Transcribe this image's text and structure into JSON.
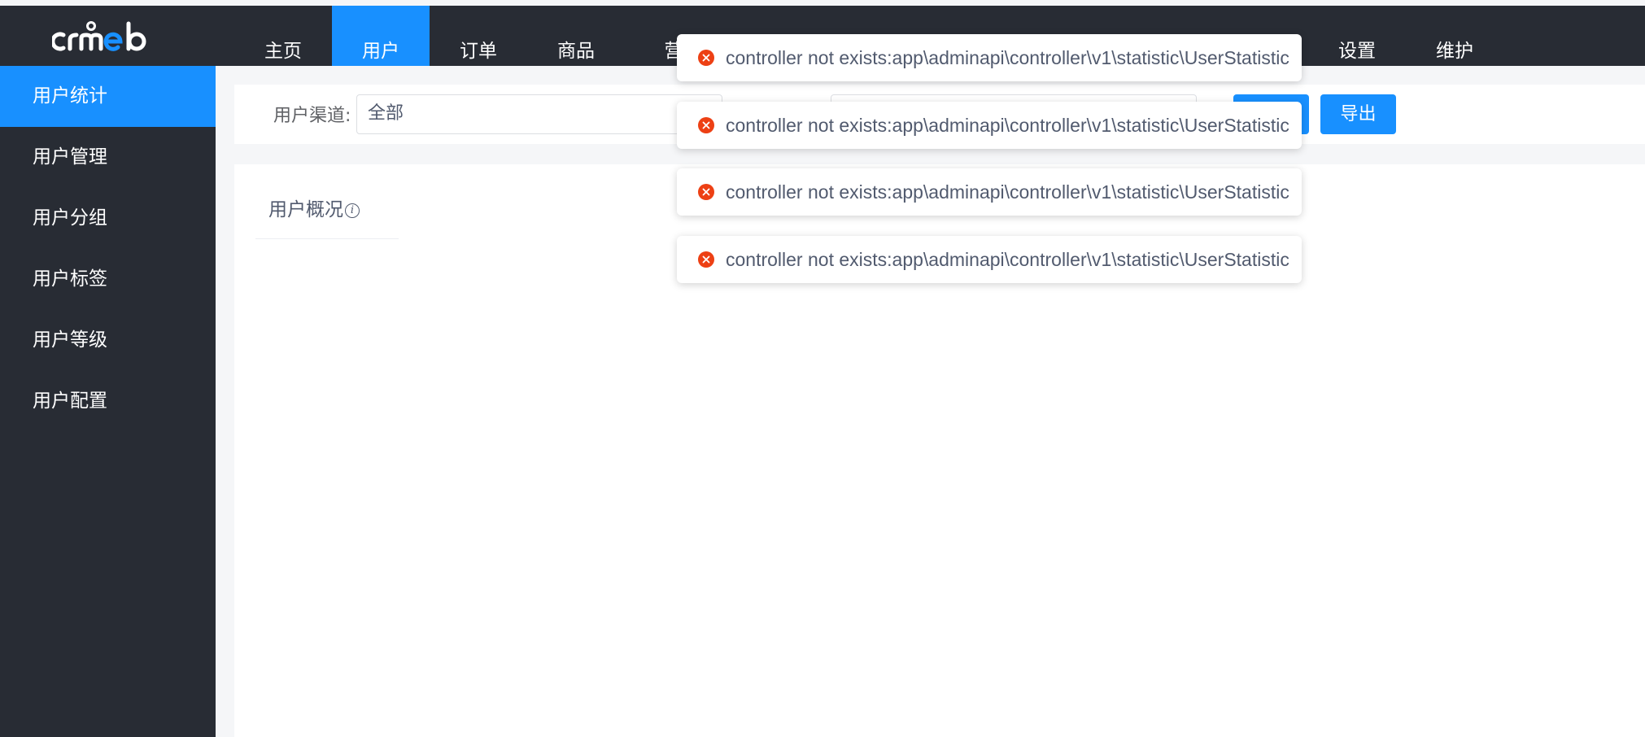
{
  "topnav": {
    "items": [
      {
        "label": "主页",
        "active": false
      },
      {
        "label": "用户",
        "active": true
      },
      {
        "label": "订单",
        "active": false
      },
      {
        "label": "商品",
        "active": false
      },
      {
        "label": "营",
        "active": false
      },
      {
        "label": "设置",
        "active": false
      },
      {
        "label": "维护",
        "active": false
      }
    ]
  },
  "sidebar": {
    "items": [
      {
        "label": "用户统计",
        "active": true
      },
      {
        "label": "用户管理",
        "active": false
      },
      {
        "label": "用户分组",
        "active": false
      },
      {
        "label": "用户标签",
        "active": false
      },
      {
        "label": "用户等级",
        "active": false
      },
      {
        "label": "用户配置",
        "active": false
      }
    ]
  },
  "filter": {
    "channel_label": "用户渠道:",
    "channel_value": "全部",
    "export_label": "导出"
  },
  "overview": {
    "tab_label": "用户概况"
  },
  "toasts": [
    {
      "message": "controller not exists:app\\adminapi\\controller\\v1\\statistic\\UserStatistic"
    },
    {
      "message": "controller not exists:app\\adminapi\\controller\\v1\\statistic\\UserStatistic"
    },
    {
      "message": "controller not exists:app\\adminapi\\controller\\v1\\statistic\\UserStatistic"
    },
    {
      "message": "controller not exists:app\\adminapi\\controller\\v1\\statistic\\UserStatistic"
    }
  ],
  "colors": {
    "accent": "#1890ff",
    "dark": "#282c34",
    "error": "#ed4014"
  }
}
